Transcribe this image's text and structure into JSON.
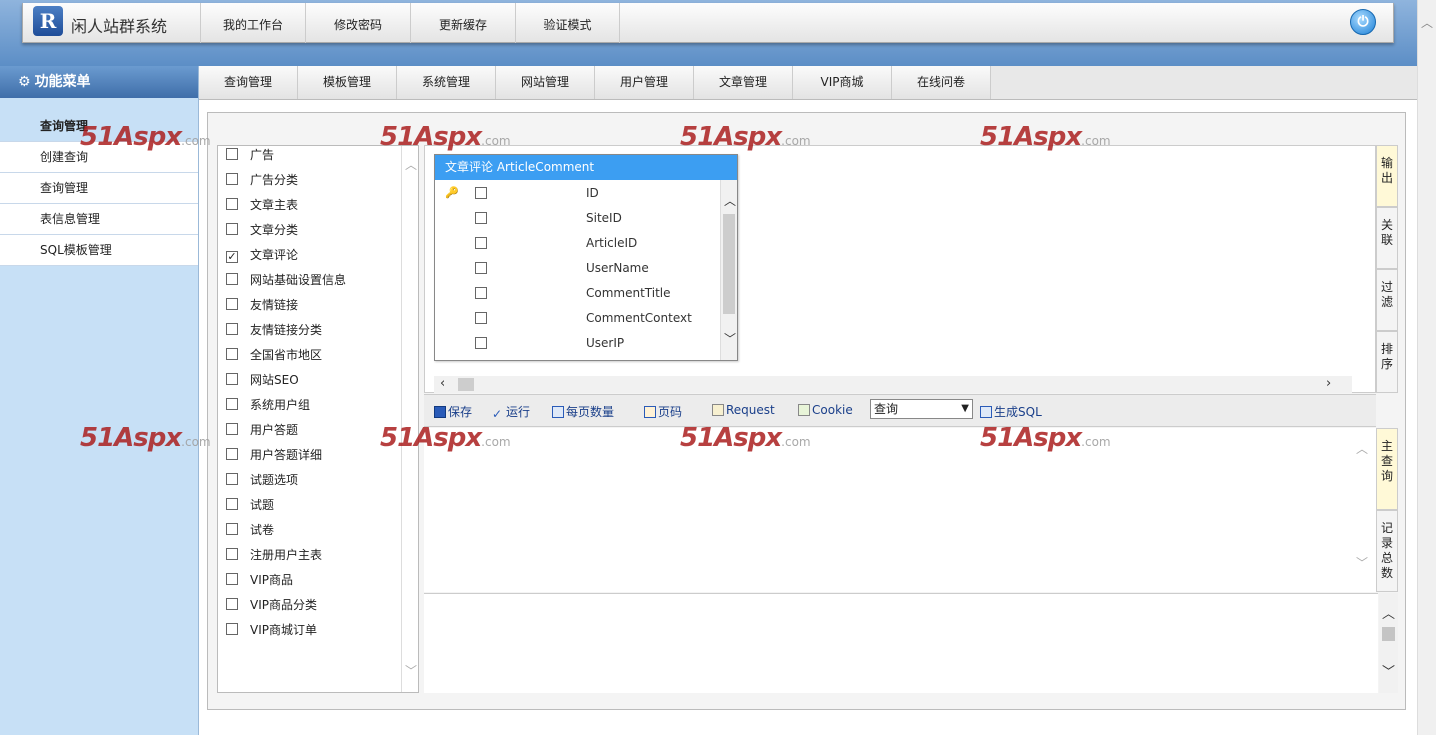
{
  "app": {
    "title": "闲人站群系统",
    "logo_letter": "R"
  },
  "topnav": [
    "我的工作台",
    "修改密码",
    "更新缓存",
    "验证模式"
  ],
  "sidebar": {
    "header": "功能菜单",
    "items": [
      "查询管理",
      "创建查询",
      "查询管理",
      "表信息管理",
      "SQL模板管理"
    ]
  },
  "tabs": [
    "查询管理",
    "模板管理",
    "系统管理",
    "网站管理",
    "用户管理",
    "文章管理",
    "VIP商城",
    "在线问卷"
  ],
  "tables": [
    {
      "label": "广告",
      "checked": false
    },
    {
      "label": "广告分类",
      "checked": false
    },
    {
      "label": "文章主表",
      "checked": false
    },
    {
      "label": "文章分类",
      "checked": false
    },
    {
      "label": "文章评论",
      "checked": true
    },
    {
      "label": "网站基础设置信息",
      "checked": false
    },
    {
      "label": "友情链接",
      "checked": false
    },
    {
      "label": "友情链接分类",
      "checked": false
    },
    {
      "label": "全国省市地区",
      "checked": false
    },
    {
      "label": "网站SEO",
      "checked": false
    },
    {
      "label": "系统用户组",
      "checked": false
    },
    {
      "label": "用户答题",
      "checked": false
    },
    {
      "label": "用户答题详细",
      "checked": false
    },
    {
      "label": "试题选项",
      "checked": false
    },
    {
      "label": "试题",
      "checked": false
    },
    {
      "label": "试卷",
      "checked": false
    },
    {
      "label": "注册用户主表",
      "checked": false
    },
    {
      "label": "VIP商品",
      "checked": false
    },
    {
      "label": "VIP商品分类",
      "checked": false
    },
    {
      "label": "VIP商城订单",
      "checked": false
    }
  ],
  "entity": {
    "title": "文章评论  ArticleComment",
    "fields": [
      "ID",
      "SiteID",
      "ArticleID",
      "UserName",
      "CommentTitle",
      "CommentContext",
      "UserIP"
    ]
  },
  "side_tabs_top": [
    "输出",
    "关联",
    "过滤",
    "排序"
  ],
  "side_tabs_bottom": [
    "主查询",
    "记录总数"
  ],
  "toolbar": {
    "save": "保存",
    "run": "运行",
    "page_size": "每页数量",
    "page_no": "页码",
    "request": "Request",
    "cookie": "Cookie",
    "select_value": "查询",
    "gen_sql": "生成SQL"
  },
  "watermark": {
    "main": "51Aspx",
    "suffix": ".com"
  },
  "colors": {
    "header_blue": "#5c8ec6",
    "sidebar_bg": "#c7e0f6",
    "entity_head": "#3c9ef2",
    "active_side_tab": "#fff9d7"
  },
  "icons": [
    "logo-icon",
    "power-icon",
    "gear-icon",
    "key-icon",
    "save-icon",
    "run-icon",
    "page-size-icon",
    "page-no-icon",
    "request-icon",
    "cookie-icon",
    "sql-icon"
  ]
}
